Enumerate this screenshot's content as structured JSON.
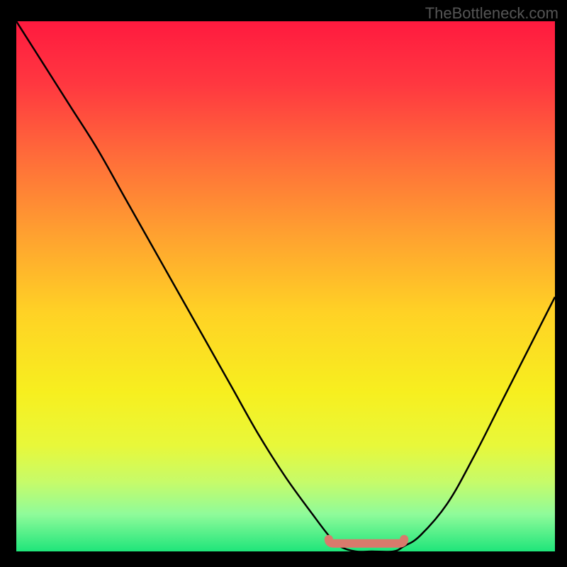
{
  "attribution": "TheBottleneck.com",
  "chart_data": {
    "type": "line",
    "title": "",
    "xlabel": "",
    "ylabel": "",
    "xlim": [
      0,
      100
    ],
    "ylim": [
      0,
      100
    ],
    "x": [
      0,
      5,
      10,
      15,
      20,
      25,
      30,
      35,
      40,
      45,
      50,
      55,
      58,
      60,
      63,
      66,
      70,
      72,
      75,
      80,
      85,
      90,
      95,
      100
    ],
    "y": [
      100,
      92,
      84,
      76,
      67,
      58,
      49,
      40,
      31,
      22,
      14,
      7,
      3,
      1,
      0,
      0,
      0,
      1,
      3,
      9,
      18,
      28,
      38,
      48
    ],
    "marker_region": {
      "x_start": 58,
      "x_end": 72,
      "y": 1.5,
      "color": "#d97a6c"
    },
    "gradient_stops": [
      {
        "offset": 0.0,
        "color": "#ff1a3f"
      },
      {
        "offset": 0.12,
        "color": "#ff3840"
      },
      {
        "offset": 0.25,
        "color": "#ff6a3a"
      },
      {
        "offset": 0.4,
        "color": "#ffa030"
      },
      {
        "offset": 0.55,
        "color": "#ffd225"
      },
      {
        "offset": 0.7,
        "color": "#f7ef1f"
      },
      {
        "offset": 0.8,
        "color": "#e8f83a"
      },
      {
        "offset": 0.87,
        "color": "#c6fb6a"
      },
      {
        "offset": 0.93,
        "color": "#8ffb9a"
      },
      {
        "offset": 1.0,
        "color": "#1fe57a"
      }
    ]
  }
}
